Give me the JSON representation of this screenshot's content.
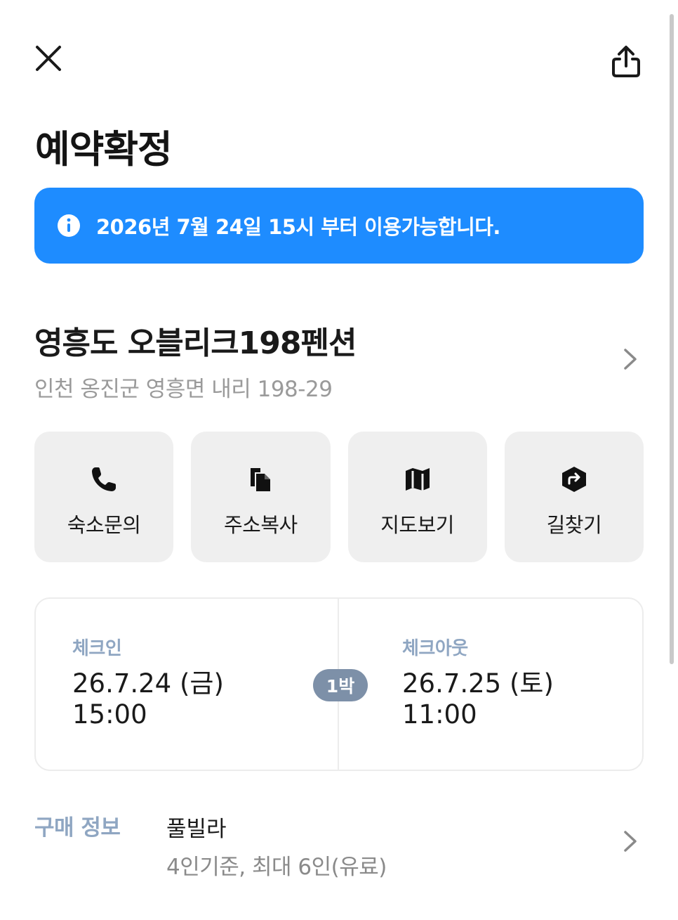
{
  "header": {
    "title": "예약확정"
  },
  "notice": {
    "text": "2026년 7월 24일 15시 부터 이용가능합니다.",
    "color": "#1e8cff"
  },
  "property": {
    "name": "영흥도 오블리크198펜션",
    "address": "인천 옹진군 영흥면 내리 198-29"
  },
  "actions": [
    {
      "label": "숙소문의",
      "icon": "phone-icon"
    },
    {
      "label": "주소복사",
      "icon": "copy-icon"
    },
    {
      "label": "지도보기",
      "icon": "map-icon"
    },
    {
      "label": "길찾기",
      "icon": "directions-icon"
    }
  ],
  "stay": {
    "checkin": {
      "label": "체크인",
      "date": "26.7.24 (금)",
      "time": "15:00"
    },
    "checkout": {
      "label": "체크아웃",
      "date": "26.7.25 (토)",
      "time": "11:00"
    },
    "nights": "1박"
  },
  "purchase": {
    "label": "구매 정보",
    "room": "풀빌라",
    "capacity": "4인기준, 최대 6인(유료)"
  }
}
